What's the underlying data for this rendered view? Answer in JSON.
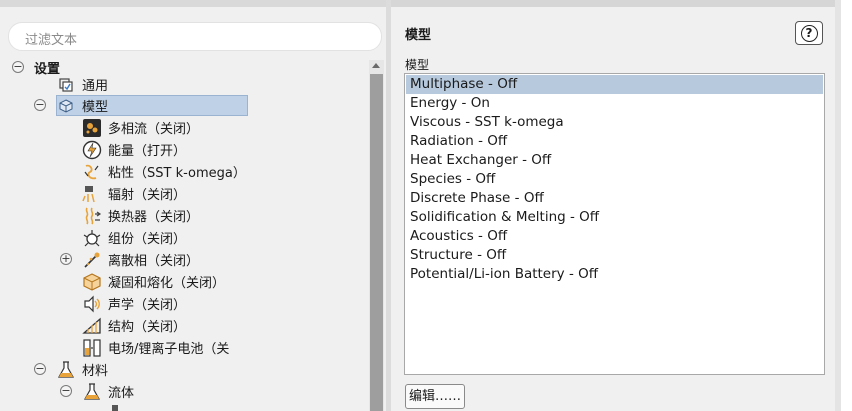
{
  "filter": {
    "placeholder": "过滤文本"
  },
  "tree": {
    "root_label": "设置",
    "items": [
      {
        "label": "通用"
      },
      {
        "label": "模型"
      },
      {
        "label": "多相流（关闭）"
      },
      {
        "label": "能量（打开）"
      },
      {
        "label": "粘性（SST k-omega）"
      },
      {
        "label": "辐射（关闭）"
      },
      {
        "label": "换热器（关闭）"
      },
      {
        "label": "组份（关闭）"
      },
      {
        "label": "离散相（关闭）"
      },
      {
        "label": "凝固和熔化（关闭）"
      },
      {
        "label": "声学（关闭）"
      },
      {
        "label": "结构（关闭）"
      },
      {
        "label": "电场/锂离子电池（关"
      },
      {
        "label": "材料"
      },
      {
        "label": "流体"
      }
    ],
    "expanders": {
      "minus": "−",
      "plus": "+"
    }
  },
  "panel": {
    "title": "模型",
    "help_glyph": "?",
    "list_label": "模型",
    "models": [
      "Multiphase - Off",
      "Energy - On",
      "Viscous - SST k-omega",
      "Radiation - Off",
      "Heat Exchanger - Off",
      "Species - Off",
      "Discrete Phase - Off",
      "Solidification & Melting - Off",
      "Acoustics - Off",
      "Structure - Off",
      "Potential/Li-ion Battery - Off"
    ],
    "selected_index": 0,
    "edit_button": "编辑……"
  },
  "colors": {
    "selection": "#bfd1e6",
    "list_selection": "#b7c9dd",
    "icon_orange": "#e8a33a"
  }
}
